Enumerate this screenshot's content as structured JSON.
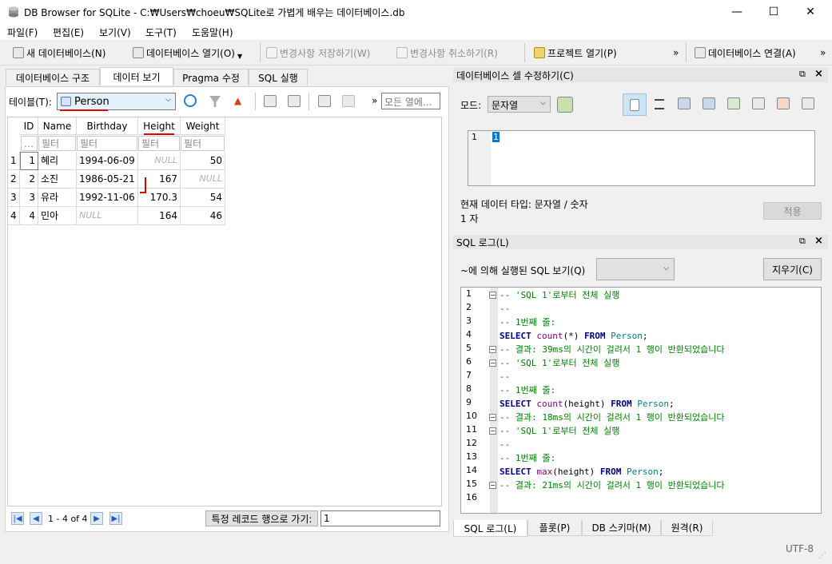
{
  "window": {
    "title": "DB Browser for SQLite - C:₩Users₩choeu₩SQLite로 가볍게 배우는 데이터베이스.db"
  },
  "menu": [
    "파일(F)",
    "편집(E)",
    "보기(V)",
    "도구(T)",
    "도움말(H)"
  ],
  "toolbar": {
    "new_db": "새 데이터베이스(N)",
    "open_db": "데이터베이스 열기(O)",
    "write_changes": "변경사항 저장하기(W)",
    "revert_changes": "변경사항 취소하기(R)",
    "open_project": "프로젝트 열기(P)",
    "more1": "»",
    "attach_db": "데이터베이스 연결(A)",
    "more2": "»"
  },
  "tabs": [
    "데이터베이스 구조",
    "데이터 보기",
    "Pragma 수정",
    "SQL 실행"
  ],
  "browse": {
    "table_label": "테이블(T):",
    "table_value": "Person",
    "more": "»",
    "filter_placeholder": "모든 열에...",
    "columns": [
      "ID",
      "Name",
      "Birthday",
      "Height",
      "Weight"
    ],
    "filter_text": "필터",
    "filter_id": "…",
    "rows": [
      {
        "n": "1",
        "id": "1",
        "name": "혜리",
        "birthday": "1994-06-09",
        "height": "NULL",
        "weight": "50"
      },
      {
        "n": "2",
        "id": "2",
        "name": "소진",
        "birthday": "1986-05-21",
        "height": "167",
        "weight": "NULL"
      },
      {
        "n": "3",
        "id": "3",
        "name": "유라",
        "birthday": "1992-11-06",
        "height": "170.3",
        "weight": "54"
      },
      {
        "n": "4",
        "id": "4",
        "name": "민아",
        "birthday": "NULL",
        "height": "164",
        "weight": "46"
      }
    ],
    "pagination": "1 - 4 of 4",
    "goto_label": "특정 레코드 행으로 가기:",
    "goto_value": "1"
  },
  "edit_cell": {
    "title": "데이터베이스 셀 수정하기(C)",
    "mode_label": "모드:",
    "mode_value": "문자열",
    "editor_line": "1",
    "editor_value": "1",
    "type_info": "현재 데이터 타입: 문자열 / 숫자",
    "size_info": "1 자",
    "apply": "적용"
  },
  "sql_log": {
    "title": "SQL 로그(L)",
    "filter_label": "~에 의해 실행된 SQL 보기(Q)",
    "clear": "지우기(C)",
    "lines": [
      "-- 'SQL 1'로부터 전체 실행",
      "--",
      "-- 1번째 줄:",
      "SELECT count(*) FROM Person;",
      "-- 결과: 39ms의 시간이 걸려서 1 행이 반환되었습니다",
      "-- 'SQL 1'로부터 전체 실행",
      "--",
      "-- 1번째 줄:",
      "SELECT count(height) FROM Person;",
      "-- 결과: 18ms의 시간이 걸려서 1 행이 반환되었습니다",
      "-- 'SQL 1'로부터 전체 실행",
      "--",
      "-- 1번째 줄:",
      "SELECT max(height) FROM Person;",
      "-- 결과: 21ms의 시간이 걸려서 1 행이 반환되었습니다",
      ""
    ]
  },
  "bottom_tabs": [
    "SQL 로그(L)",
    "플롯(P)",
    "DB 스키마(M)",
    "원격(R)"
  ],
  "status": {
    "encoding": "UTF-8"
  },
  "colors": {
    "accent": "#1e5fbf",
    "annotation": "#e00000",
    "comment": "#008000",
    "keyword": "#00007f"
  }
}
